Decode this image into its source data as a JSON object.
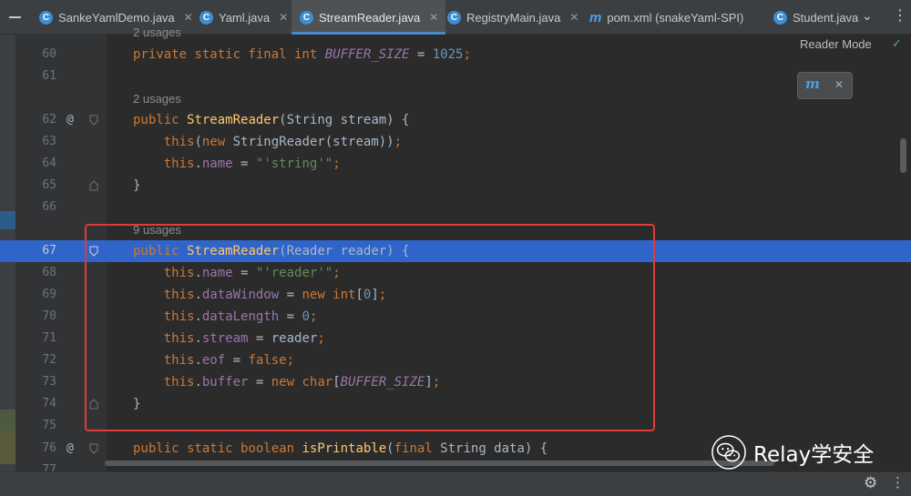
{
  "tabs": [
    {
      "label": "SankeYamlDemo.java",
      "icon": "java-class-icon",
      "active": false
    },
    {
      "label": "Yaml.java",
      "icon": "java-class-icon",
      "active": false
    },
    {
      "label": "StreamReader.java",
      "icon": "java-class-icon",
      "active": true
    },
    {
      "label": "RegistryMain.java",
      "icon": "java-class-icon",
      "active": false
    },
    {
      "label": "pom.xml (snakeYaml-SPI)",
      "icon": "maven-icon",
      "active": false
    },
    {
      "label": "Student.java",
      "icon": "java-class-icon",
      "active": false
    }
  ],
  "tab_close_glyph": "✕",
  "java_icon_glyph": "C",
  "maven_icon_glyph": "m",
  "editor": {
    "reader_mode": "Reader Mode",
    "current_line": "67",
    "lines": [
      {
        "num": "60",
        "text": "private static final int BUFFER_SIZE = 1025;"
      },
      {
        "num": "61",
        "text": ""
      },
      {
        "num": "62",
        "usages": "2 usages",
        "text": "public StreamReader(String stream) {"
      },
      {
        "num": "63",
        "text": "this(new StringReader(stream));"
      },
      {
        "num": "64",
        "text": "this.name = \"'string'\";"
      },
      {
        "num": "65",
        "text": "}"
      },
      {
        "num": "66",
        "text": ""
      },
      {
        "num": "67",
        "usages": "9 usages",
        "text": "public StreamReader(Reader reader) {"
      },
      {
        "num": "68",
        "text": "this.name = \"'reader'\";"
      },
      {
        "num": "69",
        "text": "this.dataWindow = new int[0];"
      },
      {
        "num": "70",
        "text": "this.dataLength = 0;"
      },
      {
        "num": "71",
        "text": "this.stream = reader;"
      },
      {
        "num": "72",
        "text": "this.eof = false;"
      },
      {
        "num": "73",
        "text": "this.buffer = new char[BUFFER_SIZE];"
      },
      {
        "num": "74",
        "text": "}"
      },
      {
        "num": "75",
        "text": ""
      },
      {
        "num": "76",
        "text": "public static boolean isPrintable(final String data) {"
      },
      {
        "num": "77",
        "text": ""
      }
    ],
    "top_partial_usage": "2 usages",
    "annotations": {
      "line62": "@",
      "line76": "@"
    }
  },
  "watermark": {
    "text": "Relay学安全"
  },
  "colors": {
    "accent": "#2f65ca",
    "redbox": "#e03a3a",
    "keyword": "#cc7832",
    "function": "#ffc66d",
    "field": "#9876aa",
    "string": "#6a8759",
    "number": "#6897bb"
  }
}
